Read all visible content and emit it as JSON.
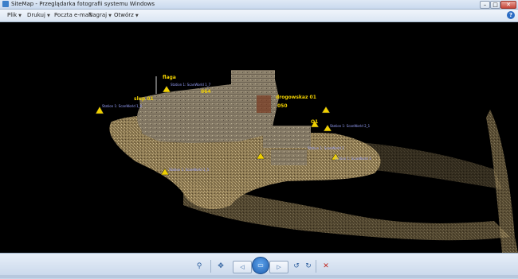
{
  "window": {
    "title": "SiteMap - Przeglądarka fotografii systemu Windows",
    "controls": {
      "minimize": "–",
      "maximize": "□",
      "close": "✕"
    }
  },
  "menu": {
    "items": [
      {
        "label": "Plik",
        "has_dropdown": true
      },
      {
        "label": "Drukuj",
        "has_dropdown": true
      },
      {
        "label": "Poczta e-mail",
        "has_dropdown": false
      },
      {
        "label": "Nagraj",
        "has_dropdown": true
      },
      {
        "label": "Otwórz",
        "has_dropdown": true
      }
    ],
    "help": "?"
  },
  "scene": {
    "labels": {
      "flaga": "flaga",
      "drogowskaz": "drogowskaz 01",
      "code_064": "064",
      "code_050": "050",
      "code_o1": "O1",
      "sl_left": "slup 01"
    },
    "stations": [
      "Station 1: ScanWorld 1_6",
      "Station 1: ScanWorld 1_7",
      "Station 1: ScanWorld 2_1",
      "Station 1: ScanWorld 2",
      "Station 1: ScanWorld 3",
      "Station 1: ScanWorld 1_5"
    ]
  },
  "toolbar": {
    "zoom": "⚲",
    "fit": "✥",
    "prev": "◁",
    "slideshow": "▭",
    "next": "▷",
    "rotate_ccw": "↺",
    "rotate_cw": "↻",
    "delete": "✕"
  },
  "colors": {
    "background": "#000000",
    "point_cloud": "#c9b483",
    "station_label": "#9aa3ff",
    "marker": "#f0d000"
  }
}
